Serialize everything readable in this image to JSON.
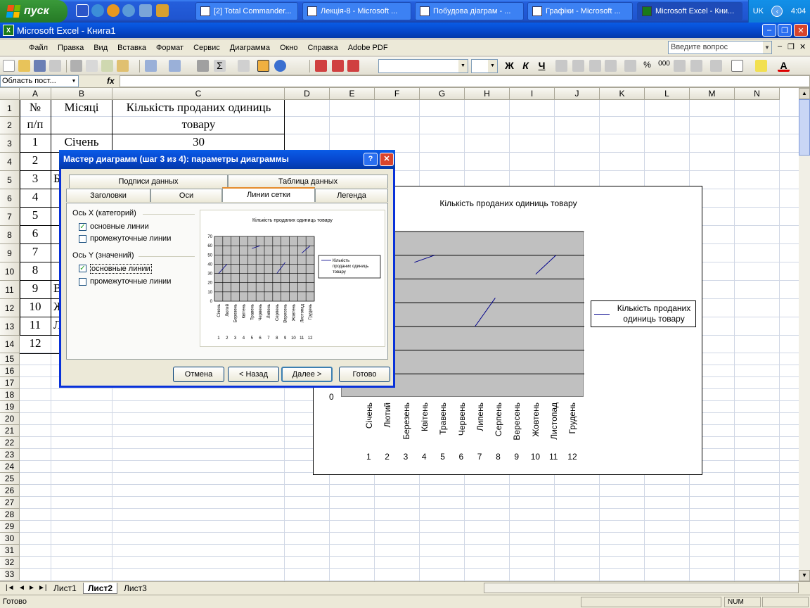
{
  "taskbar": {
    "start_label": "пуск",
    "tasks": [
      {
        "label": "[2] Total Commander..."
      },
      {
        "label": "Лекція-8 - Microsoft ..."
      },
      {
        "label": "Побудова діаграм - ..."
      },
      {
        "label": "Графіки - Microsoft ..."
      },
      {
        "label": "Microsoft Excel - Кни..."
      }
    ],
    "lang": "UK",
    "clock": "4:04"
  },
  "window": {
    "title": "Microsoft Excel - Книга1"
  },
  "menu": {
    "items": [
      "Файл",
      "Правка",
      "Вид",
      "Вставка",
      "Формат",
      "Сервис",
      "Диаграмма",
      "Окно",
      "Справка",
      "Adobe PDF"
    ],
    "ask_placeholder": "Введите вопрос"
  },
  "formula": {
    "namebox": "Область пост...",
    "fx": "fx"
  },
  "sheet": {
    "columns": [
      "A",
      "B",
      "C",
      "D",
      "E",
      "F",
      "G",
      "H",
      "I",
      "J",
      "K",
      "L",
      "M",
      "N"
    ],
    "header_row": {
      "a": "№",
      "a2": "п/п",
      "b": "Місяці",
      "c1": "Кількість проданих одиниць",
      "c2": "товару"
    },
    "row3": {
      "a": "1",
      "b": "Січень",
      "c": "30"
    },
    "rows_partial": [
      "2",
      "3",
      "4",
      "5",
      "6",
      "7",
      "8",
      "9",
      "10",
      "11",
      "12"
    ],
    "row_peeks": {
      "r5": "Б",
      "r11": "В",
      "r12": "Ж",
      "r13": "Л"
    }
  },
  "chart": {
    "title": "Кількість проданих одиниць товару",
    "legend": "Кількість проданих одиниць товару",
    "zero_label": "0",
    "months": [
      "Січень",
      "Лютий",
      "Березень",
      "Квітень",
      "Травень",
      "Червень",
      "Липень",
      "Серпень",
      "Вересень",
      "Жовтень",
      "Листопад",
      "Грудень"
    ],
    "numbers": [
      "1",
      "2",
      "3",
      "4",
      "5",
      "6",
      "7",
      "8",
      "9",
      "10",
      "11",
      "12"
    ]
  },
  "chart_data": {
    "type": "line",
    "title": "Кількість проданих одиниць товару",
    "categories": [
      "Січень",
      "Лютий",
      "Березень",
      "Квітень",
      "Травень",
      "Червень",
      "Липень",
      "Серпень",
      "Вересень",
      "Жовтень",
      "Листопад",
      "Грудень"
    ],
    "series": [
      {
        "name": "Кількість проданих одиниць товару",
        "values": [
          30,
          40,
          null,
          null,
          57,
          60,
          null,
          30,
          42,
          null,
          52,
          60
        ]
      }
    ],
    "ylim": [
      0,
      70
    ],
    "yticks": [
      0,
      10,
      20,
      30,
      40,
      50,
      60,
      70
    ],
    "grid": "major-horizontal",
    "legend": "right"
  },
  "dialog": {
    "title": "Мастер диаграмм (шаг 3 из 4): параметры диаграммы",
    "help": "?",
    "close": "✕",
    "tabs_row1": [
      "Подписи данных",
      "Таблица данных"
    ],
    "tabs_row2": [
      "Заголовки",
      "Оси",
      "Линии сетки",
      "Легенда"
    ],
    "x_group": "Ось X (категорий)",
    "y_group": "Ось Y (значений)",
    "x_major": "основные линии",
    "x_minor": "промежуточные линии",
    "y_major": "основные линии",
    "y_minor": "промежуточные линии",
    "buttons": {
      "cancel": "Отмена",
      "back": "< Назад",
      "next": "Далее >",
      "finish": "Готово"
    },
    "preview": {
      "title": "Кількість проданих одиниць товару",
      "legend": "Кількість проданих одиниць товару",
      "yticks": [
        "70",
        "60",
        "50",
        "40",
        "30",
        "20",
        "10",
        "0"
      ]
    }
  },
  "sheets": {
    "tabs": [
      "Лист1",
      "Лист2",
      "Лист3"
    ],
    "active": "Лист2"
  },
  "status": {
    "text": "Готово",
    "num": "NUM"
  }
}
